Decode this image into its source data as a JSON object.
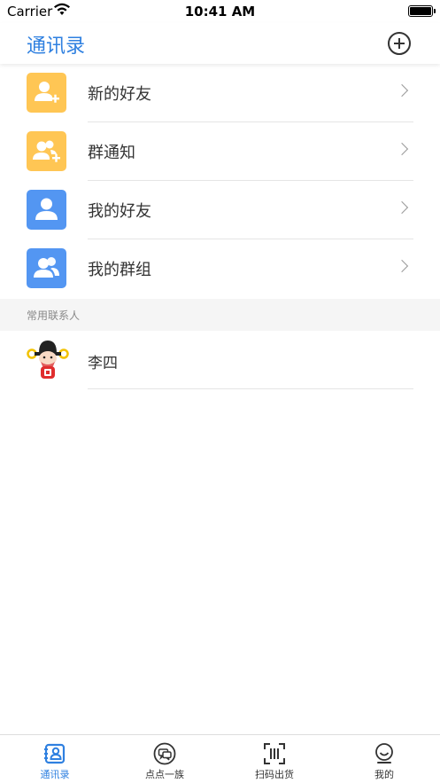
{
  "status_bar": {
    "carrier": "Carrier",
    "time": "10:41 AM"
  },
  "nav": {
    "title": "通讯录"
  },
  "menu": [
    {
      "label": "新的好友",
      "icon": "add-user-icon",
      "color": "#ffc654"
    },
    {
      "label": "群通知",
      "icon": "group-add-icon",
      "color": "#ffc654"
    },
    {
      "label": "我的好友",
      "icon": "user-icon",
      "color": "#5396f2"
    },
    {
      "label": "我的群组",
      "icon": "group-icon",
      "color": "#5396f2"
    }
  ],
  "section": {
    "title": "常用联系人"
  },
  "contacts": [
    {
      "name": "李四",
      "avatar": "cartoon-avatar"
    }
  ],
  "tabs": [
    {
      "label": "通讯录",
      "icon": "contacts-icon",
      "active": true
    },
    {
      "label": "点点一族",
      "icon": "chat-icon",
      "active": false
    },
    {
      "label": "扫码出货",
      "icon": "scan-icon",
      "active": false
    },
    {
      "label": "我的",
      "icon": "profile-icon",
      "active": false
    }
  ],
  "colors": {
    "accent": "#2f80e0",
    "orange": "#ffc654",
    "blue": "#5396f2"
  }
}
